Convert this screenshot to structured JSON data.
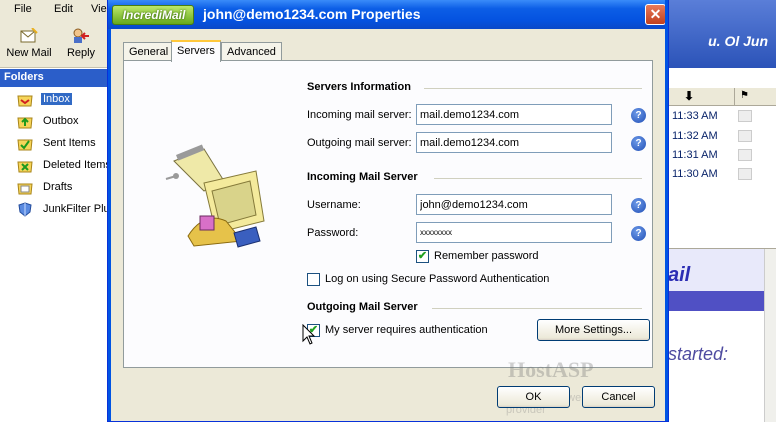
{
  "background_app": {
    "menu": [
      "File",
      "Edit",
      "Vie"
    ],
    "toolbar": [
      {
        "label": "New Mail",
        "icon": "new-mail-icon"
      },
      {
        "label": "Reply",
        "icon": "reply-icon"
      }
    ],
    "folders_header": "Folders",
    "folders": [
      {
        "label": "Inbox",
        "icon": "inbox-icon",
        "selected": true
      },
      {
        "label": "Outbox",
        "icon": "outbox-icon"
      },
      {
        "label": "Sent Items",
        "icon": "sent-items-icon"
      },
      {
        "label": "Deleted Items",
        "icon": "deleted-items-icon"
      },
      {
        "label": "Drafts",
        "icon": "drafts-icon"
      },
      {
        "label": "JunkFilter Plu",
        "icon": "junkfilter-icon"
      }
    ],
    "date_banner": "u. Ol Jun",
    "messages": [
      {
        "time": "11:33 AM"
      },
      {
        "time": "11:32 AM"
      },
      {
        "time": "11:31 AM"
      },
      {
        "time": "11:30 AM"
      }
    ],
    "preview": {
      "banner_text": "ail",
      "body_text": "started:"
    }
  },
  "dialog": {
    "brand": "IncrediMail",
    "title": "john@demo1234.com Properties",
    "tabs": [
      {
        "label": "General",
        "active": false
      },
      {
        "label": "Servers",
        "active": true
      },
      {
        "label": "Advanced",
        "active": false
      }
    ],
    "servers_info": {
      "title": "Servers Information",
      "incoming_label": "Incoming mail server:",
      "incoming_value": "mail.demo1234.com",
      "outgoing_label": "Outgoing mail server:",
      "outgoing_value": "mail.demo1234.com"
    },
    "incoming_server": {
      "title": "Incoming Mail Server",
      "username_label": "Username:",
      "username_value": "john@demo1234.com",
      "password_label": "Password:",
      "password_value": "xxxxxxxx",
      "remember_label": "Remember password",
      "remember_checked": true,
      "spa_label": "Log on using Secure Password Authentication",
      "spa_checked": false
    },
    "outgoing_server": {
      "title": "Outgoing Mail Server",
      "auth_label": "My server requires authentication",
      "auth_checked": true,
      "more_settings_label": "More Settings..."
    },
    "buttons": {
      "ok": "OK",
      "cancel": "Cancel"
    }
  },
  "watermark": {
    "title": "HostASP",
    "subtitle": "your trusted web hosting provider"
  },
  "colors": {
    "titlebar": "#0552e0",
    "brand_green": "#67a91c",
    "accent_tab": "#ffc83c"
  }
}
